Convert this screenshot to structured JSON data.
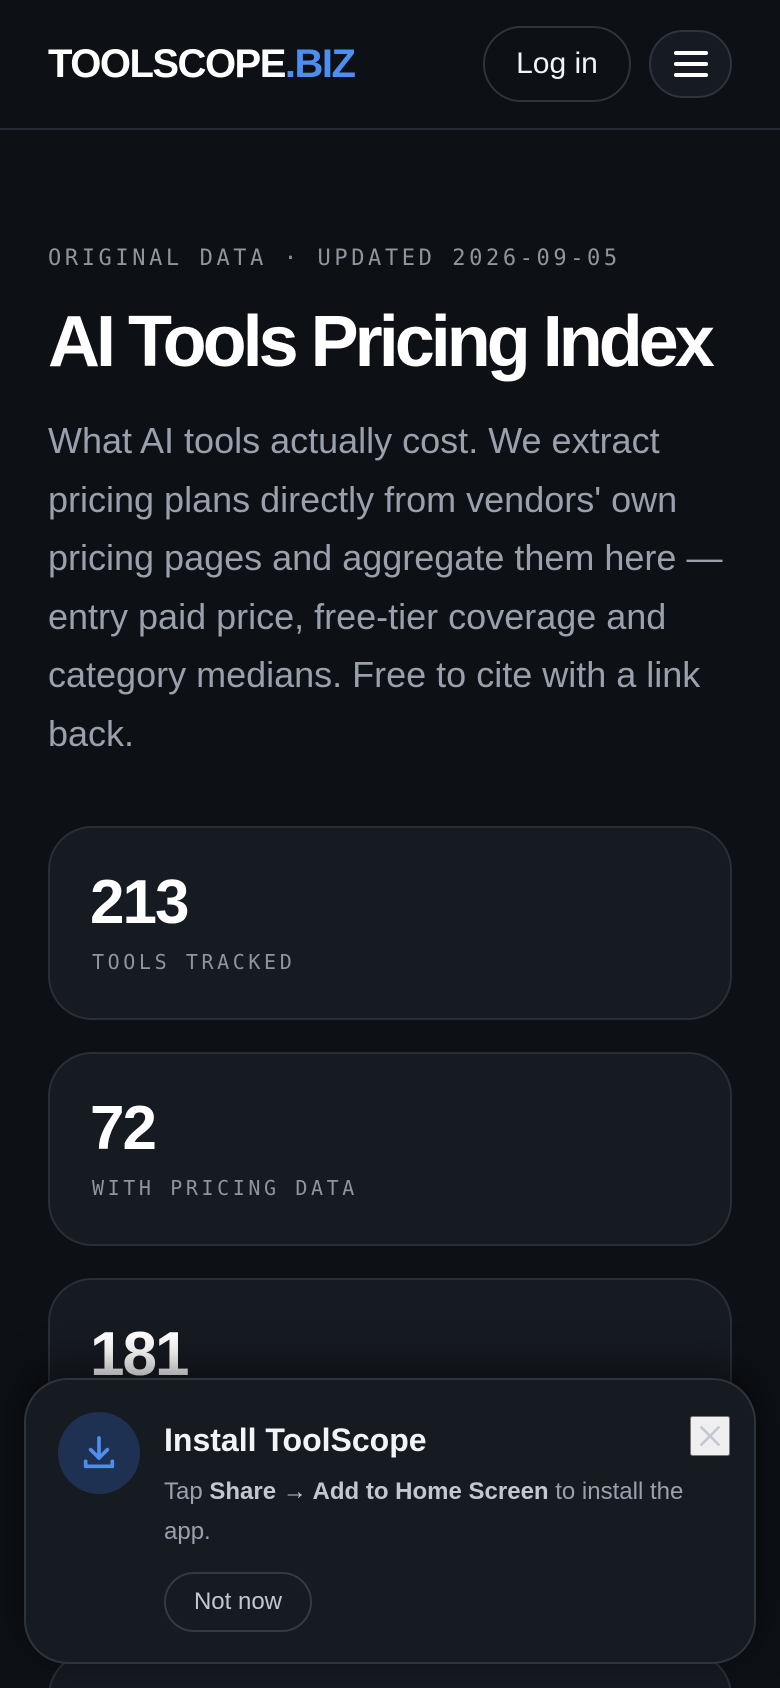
{
  "header": {
    "logo_main": "TOOLSCOPE",
    "logo_accent": ".BIZ",
    "login_label": "Log in",
    "menu_icon": "hamburger-menu-icon"
  },
  "hero": {
    "eyebrow": "ORIGINAL DATA · UPDATED 2026-09-05",
    "title": "AI Tools Pricing Index",
    "description": "What AI tools actually cost. We extract pricing plans directly from vendors' own pricing pages and aggregate them here — entry paid price, free-tier coverage and category medians. Free to cite with a link back."
  },
  "stats": [
    {
      "value": "213",
      "label": "TOOLS TRACKED"
    },
    {
      "value": "72",
      "label": "WITH PRICING DATA"
    },
    {
      "value": "181",
      "label": ""
    }
  ],
  "install": {
    "title": "Install ToolScope",
    "text_prefix": "Tap ",
    "text_bold_1": "Share",
    "text_arrow": " → ",
    "text_bold_2": "Add to Home Screen",
    "text_suffix": " to install the app.",
    "not_now_label": "Not now",
    "icon": "download-icon",
    "close_icon": "close-icon"
  },
  "colors": {
    "background": "#0d1015",
    "card": "#161a21",
    "accent": "#4d8ff0",
    "muted_text": "#9aa1ac"
  }
}
